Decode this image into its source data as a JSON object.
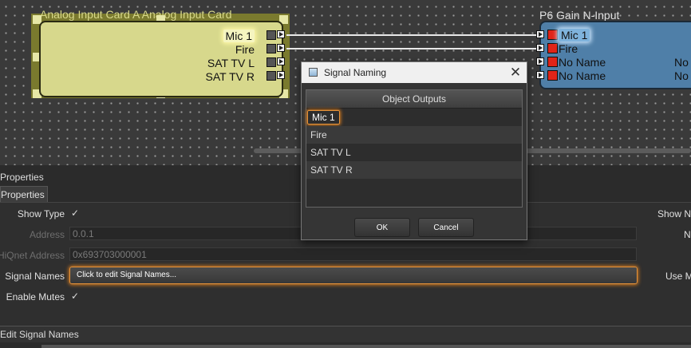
{
  "canvas": {
    "card_a": {
      "title": "Analog Input Card A  Analog Input Card",
      "outputs": [
        "Mic 1",
        "Fire",
        "SAT TV L",
        "SAT TV R"
      ]
    },
    "card_b": {
      "title": "P6  Gain N-Input",
      "inputs": [
        "Mic 1",
        "Fire",
        "No Name",
        "No Name"
      ],
      "right_labels": [
        "No",
        "No"
      ]
    }
  },
  "properties": {
    "dock_title": "Properties",
    "tab_label": "Properties",
    "show_type": {
      "label": "Show Type",
      "check": "✓"
    },
    "address": {
      "label": "Address",
      "value": "0.0.1"
    },
    "hiqnet": {
      "label": "HiQnet Address",
      "value": "0x693703000001"
    },
    "signal_names": {
      "label": "Signal Names",
      "button": "Click to edit Signal Names..."
    },
    "enable_mutes": {
      "label": "Enable Mutes",
      "check": "✓"
    },
    "right": {
      "show": "Show N",
      "n": "N",
      "use": "Use M"
    }
  },
  "status": {
    "text": "Edit Signal Names"
  },
  "dialog": {
    "title": "Signal Naming",
    "close": "✕",
    "column_header": "Object Outputs",
    "rows": [
      "Mic 1",
      "Fire",
      "SAT TV L",
      "SAT TV R"
    ],
    "ok": "OK",
    "cancel": "Cancel"
  }
}
